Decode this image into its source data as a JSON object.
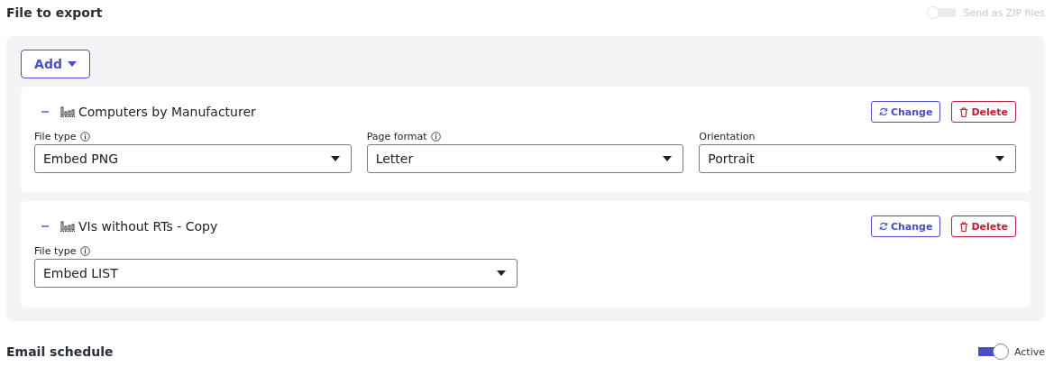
{
  "title": "File to export",
  "zip_toggle": {
    "label": "Send as ZIP files",
    "on": false,
    "disabled": true
  },
  "add_button": {
    "label": "Add"
  },
  "files": [
    {
      "name": "Computers by Manufacturer",
      "expanded": true,
      "change_label": "Change",
      "delete_label": "Delete",
      "fields": [
        {
          "label": "File type",
          "info": true,
          "value": "Embed PNG"
        },
        {
          "label": "Page format",
          "info": true,
          "value": "Letter"
        },
        {
          "label": "Orientation",
          "info": false,
          "value": "Portrait"
        }
      ]
    },
    {
      "name": "VIs without RTs - Copy",
      "expanded": true,
      "change_label": "Change",
      "delete_label": "Delete",
      "fields": [
        {
          "label": "File type",
          "info": true,
          "value": "Embed LIST"
        }
      ]
    }
  ],
  "schedule": {
    "title": "Email schedule",
    "toggle": {
      "label": "Active",
      "on": true,
      "disabled": false
    }
  }
}
